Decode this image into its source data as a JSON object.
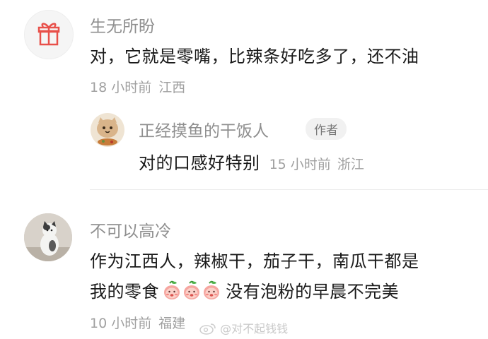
{
  "comment1": {
    "username": "生无所盼",
    "content": "对，它就是零嘴，比辣条好吃多了，还不油",
    "time": "18 小时前",
    "location": "江西",
    "avatar_icon": "gift-icon"
  },
  "reply1": {
    "username": "正经摸鱼的干饭人",
    "badge": "作者",
    "content": "对的口感好特别",
    "time": "15 小时前",
    "location": "浙江",
    "avatar_icon": "cartoon-cat-avatar"
  },
  "comment2": {
    "username": "不可以高冷",
    "content_line1": "作为江西人，辣椒干，茄子干，南瓜干都是",
    "content_line2_text": "没有泡粉的早晨不完美",
    "content_line2_prefix": "我的零食",
    "emoji_icon": "peach-face-emoji",
    "emoji_count": 3,
    "time": "10 小时前",
    "location": "福建",
    "avatar_icon": "cat-photo-avatar"
  },
  "watermark": {
    "text": "@对不起钱钱",
    "icon": "weibo-icon"
  },
  "colors": {
    "username": "#8f8f8f",
    "meta": "#a0a0a0",
    "gift_red": "#e8504a"
  }
}
